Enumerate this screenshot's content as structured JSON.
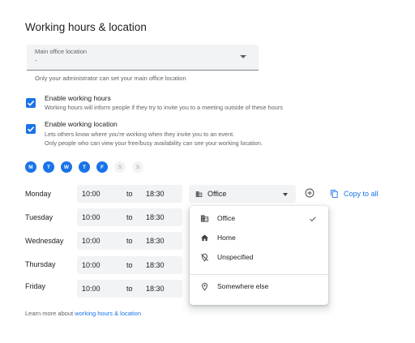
{
  "section_title": "Working hours & location",
  "office_select": {
    "label": "Main office location",
    "value": "-",
    "hint": "Only your administrator can set your main office location"
  },
  "options": {
    "working_hours": {
      "title": "Enable working hours",
      "desc": "Working hours will inform people if they try to invite you to a meeting outside of these hours",
      "checked": true
    },
    "working_location": {
      "title": "Enable working location",
      "desc1": "Lets others know where you're working when they invite you to an event.",
      "desc2": "Only people who can view your free/busy availability can see your working location.",
      "checked": true
    }
  },
  "day_pills": [
    {
      "letter": "M",
      "on": true
    },
    {
      "letter": "T",
      "on": true
    },
    {
      "letter": "W",
      "on": true
    },
    {
      "letter": "T",
      "on": true
    },
    {
      "letter": "F",
      "on": true
    },
    {
      "letter": "S",
      "on": false
    },
    {
      "letter": "S",
      "on": false
    }
  ],
  "schedule": [
    {
      "day": "Monday",
      "start": "10:00",
      "to": "to",
      "end": "18:30"
    },
    {
      "day": "Tuesday",
      "start": "10:00",
      "to": "to",
      "end": "18:30"
    },
    {
      "day": "Wednesday",
      "start": "10:00",
      "to": "to",
      "end": "18:30"
    },
    {
      "day": "Thursday",
      "start": "10:00",
      "to": "to",
      "end": "18:30"
    },
    {
      "day": "Friday",
      "start": "10:00",
      "to": "to",
      "end": "18:30"
    }
  ],
  "location_select": {
    "value": "Office"
  },
  "copy_label": "Copy to all",
  "location_menu": {
    "items": [
      {
        "label": "Office",
        "icon": "building-icon",
        "selected": true
      },
      {
        "label": "Home",
        "icon": "home-icon",
        "selected": false
      },
      {
        "label": "Unspecified",
        "icon": "location-off-icon",
        "selected": false
      },
      {
        "label": "Somewhere else",
        "icon": "location-pin-icon",
        "selected": false
      }
    ]
  },
  "footer": {
    "prefix": "Learn more about ",
    "link": "working hours & location"
  },
  "colors": {
    "accent": "#1a73e8",
    "field_bg": "#f1f3f4",
    "text": "#202124",
    "muted": "#5f6368"
  }
}
